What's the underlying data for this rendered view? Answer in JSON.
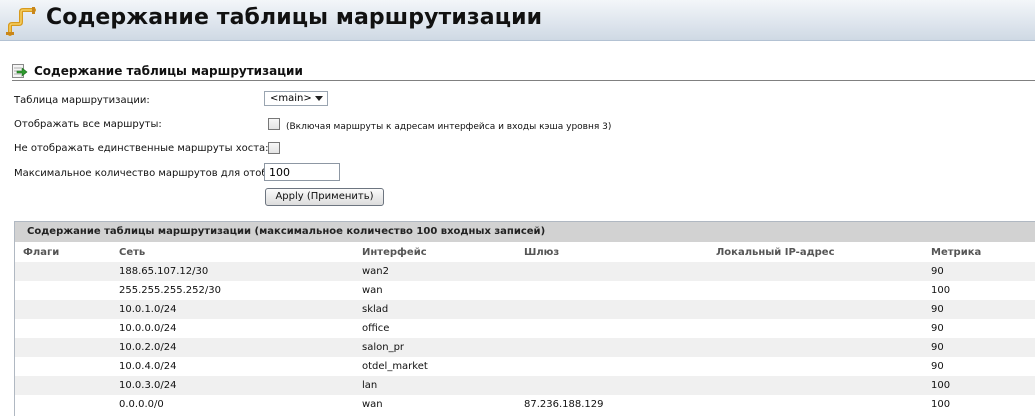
{
  "header": {
    "title": "Содержание таблицы маршрутизации"
  },
  "section": {
    "title": "Содержание таблицы маршрутизации"
  },
  "form": {
    "routing_table_label": "Таблица маршрутизации:",
    "routing_table_value": "<main>",
    "show_all_label": "Отображать все маршруты:",
    "show_all_checked": false,
    "show_all_hint": "(Включая маршруты к адресам интерфейса и входы кэша уровня 3)",
    "hide_host_label": "Не отображать единственные маршруты хоста:",
    "hide_host_checked": false,
    "max_routes_label": "Максимальное количество маршрутов для отображения:",
    "max_routes_value": "100",
    "apply_label": "Apply (Применить)"
  },
  "table": {
    "title": "Содержание таблицы маршрутизации (максимальное количество 100 входных записей)",
    "columns": {
      "flags": "Флаги",
      "network": "Сеть",
      "interface": "Интерфейс",
      "gateway": "Шлюз",
      "local_ip": "Локальный IP-адрес",
      "metric": "Метрика"
    },
    "rows": [
      {
        "flags": "",
        "network": "188.65.107.12/30",
        "interface": "wan2",
        "gateway": "",
        "local_ip": "",
        "metric": "90"
      },
      {
        "flags": "",
        "network": "255.255.255.252/30",
        "interface": "wan",
        "gateway": "",
        "local_ip": "",
        "metric": "100"
      },
      {
        "flags": "",
        "network": "10.0.1.0/24",
        "interface": "sklad",
        "gateway": "",
        "local_ip": "",
        "metric": "90"
      },
      {
        "flags": "",
        "network": "10.0.0.0/24",
        "interface": "office",
        "gateway": "",
        "local_ip": "",
        "metric": "90"
      },
      {
        "flags": "",
        "network": "10.0.2.0/24",
        "interface": "salon_pr",
        "gateway": "",
        "local_ip": "",
        "metric": "90"
      },
      {
        "flags": "",
        "network": "10.0.4.0/24",
        "interface": "otdel_market",
        "gateway": "",
        "local_ip": "",
        "metric": "90"
      },
      {
        "flags": "",
        "network": "10.0.3.0/24",
        "interface": "lan",
        "gateway": "",
        "local_ip": "",
        "metric": "100"
      },
      {
        "flags": "",
        "network": "0.0.0.0/0",
        "interface": "wan",
        "gateway": "87.236.188.129",
        "local_ip": "",
        "metric": "100"
      }
    ]
  },
  "icons": {
    "header": "routing-pipe-icon",
    "section": "green-arrow-icon"
  },
  "colors": {
    "header_bg": "#dfe6ee",
    "panel_title_bg": "#d2d2d2",
    "row_alt_bg": "#f0f0f0"
  }
}
